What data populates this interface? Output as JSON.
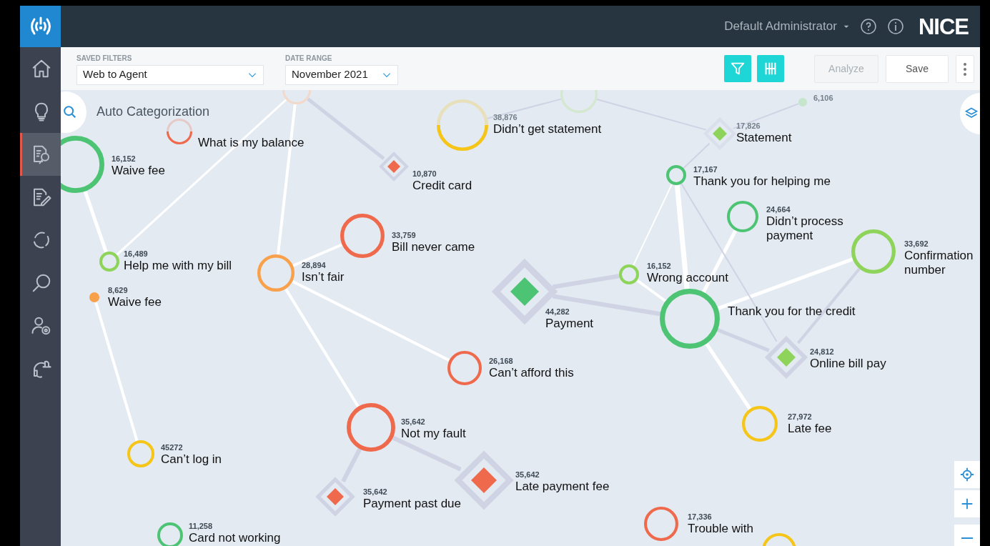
{
  "header": {
    "user": "Default Administrator",
    "brand": "NICE"
  },
  "sidebar": {
    "items": [
      {
        "selected": false
      },
      {
        "selected": false
      },
      {
        "selected": true
      },
      {
        "selected": false
      },
      {
        "selected": false
      },
      {
        "selected": false
      },
      {
        "selected": false
      },
      {
        "selected": false
      }
    ]
  },
  "toolbar": {
    "saved_filters": {
      "label": "SAVED FILTERS",
      "value": "Web to Agent"
    },
    "date_range": {
      "label": "DATE RANGE",
      "value": "November 2021"
    },
    "tools": [
      {
        "kind": "filter",
        "active": true
      },
      {
        "kind": "columns",
        "active": true
      }
    ],
    "buttons": [
      {
        "label": "Analyze",
        "disabled": true
      },
      {
        "label": "Save",
        "disabled": false
      }
    ]
  },
  "canvas": {
    "title": "Auto Categorization",
    "nodes": [
      {
        "kind": "ring",
        "color": "#f3d9c9",
        "faded": true,
        "partial": false
      },
      {
        "kind": "ring",
        "color": "#d3e8cf",
        "faded": true,
        "partial": false
      },
      {
        "kind": "dot",
        "color": "#c5e6cc",
        "count": "6,106",
        "faded": true,
        "partial": false
      },
      {
        "kind": "ring",
        "color": "#ef6a4c",
        "label": "What is my balance",
        "faded": true,
        "partial": true
      },
      {
        "kind": "ring",
        "color": "#f5c518",
        "count": "38,876",
        "label": "Didn’t get statement",
        "faded": true,
        "partial": true
      },
      {
        "kind": "diamond",
        "color": "#8fd45a",
        "count": "17,826",
        "label": "Statement",
        "faded": true,
        "partial": false
      },
      {
        "kind": "ring",
        "color": "#4dc473",
        "count": "16,152",
        "label": "Waive fee",
        "faded": false,
        "partial": false
      },
      {
        "kind": "diamond",
        "color": "#ef6a4c",
        "count": "10,870",
        "label": "Credit card",
        "faded": false,
        "partial": false
      },
      {
        "kind": "ring",
        "color": "#4dc473",
        "count": "17,167",
        "label": "Thank you for helping me",
        "faded": false,
        "partial": false
      },
      {
        "kind": "ring",
        "color": "#4dc473",
        "count": "24,664",
        "label": "Didn’t process\npayment",
        "faded": false,
        "partial": false
      },
      {
        "kind": "ring",
        "color": "#8fd45a",
        "count": "16,489",
        "label": "Help me with my bill",
        "faded": false,
        "partial": false
      },
      {
        "kind": "ring",
        "color": "#f9a04b",
        "count": "28,894",
        "label": "Isn’t fair",
        "faded": false,
        "partial": false
      },
      {
        "kind": "ring",
        "color": "#ef6a4c",
        "count": "33,759",
        "label": "Bill never came",
        "faded": false,
        "partial": false
      },
      {
        "kind": "ring",
        "color": "#8fd45a",
        "count": "16,152",
        "label": "Wrong account",
        "faded": false,
        "partial": false
      },
      {
        "kind": "ring",
        "color": "#8fd45a",
        "count": "33,692",
        "label": "Confirmation\nnumber",
        "faded": false,
        "partial": false
      },
      {
        "kind": "dot",
        "color": "#f9a04b",
        "count": "8,629",
        "label": "Waive fee",
        "faded": false,
        "partial": false
      },
      {
        "kind": "diamond",
        "color": "#4dc473",
        "count": "44,282",
        "label": "Payment",
        "faded": false,
        "partial": false
      },
      {
        "kind": "ring",
        "color": "#4dc473",
        "label": "Thank you for the credit",
        "faded": false,
        "partial": false
      },
      {
        "kind": "ring",
        "color": "#ef6a4c",
        "count": "26,168",
        "label": "Can’t afford this",
        "faded": false,
        "partial": false
      },
      {
        "kind": "diamond",
        "color": "#8fd45a",
        "count": "24,812",
        "label": "Online bill pay",
        "faded": false,
        "partial": false
      },
      {
        "kind": "ring",
        "color": "#ef6a4c",
        "count": "35,642",
        "label": "Not my fault",
        "faded": false,
        "partial": false
      },
      {
        "kind": "ring",
        "color": "#f5c518",
        "count": "27,972",
        "label": "Late fee",
        "faded": false,
        "partial": false
      },
      {
        "kind": "ring",
        "color": "#f5c518",
        "count": "45272",
        "label": "Can’t log in",
        "faded": false,
        "partial": false
      },
      {
        "kind": "diamond",
        "color": "#ef6a4c",
        "count": "35,642",
        "label": "Payment past due",
        "faded": false,
        "partial": false
      },
      {
        "kind": "diamond",
        "color": "#ef6a4c",
        "count": "35,642",
        "label": "Late payment fee",
        "faded": false,
        "partial": false
      },
      {
        "kind": "ring",
        "color": "#4dc473",
        "count": "11,258",
        "label": "Card not working",
        "faded": false,
        "partial": false
      },
      {
        "kind": "ring",
        "color": "#ef6a4c",
        "count": "17,336",
        "label": "Trouble with",
        "faded": false,
        "partial": false
      },
      {
        "kind": "ring",
        "color": "#f5c518",
        "faded": false,
        "partial": false
      }
    ]
  }
}
